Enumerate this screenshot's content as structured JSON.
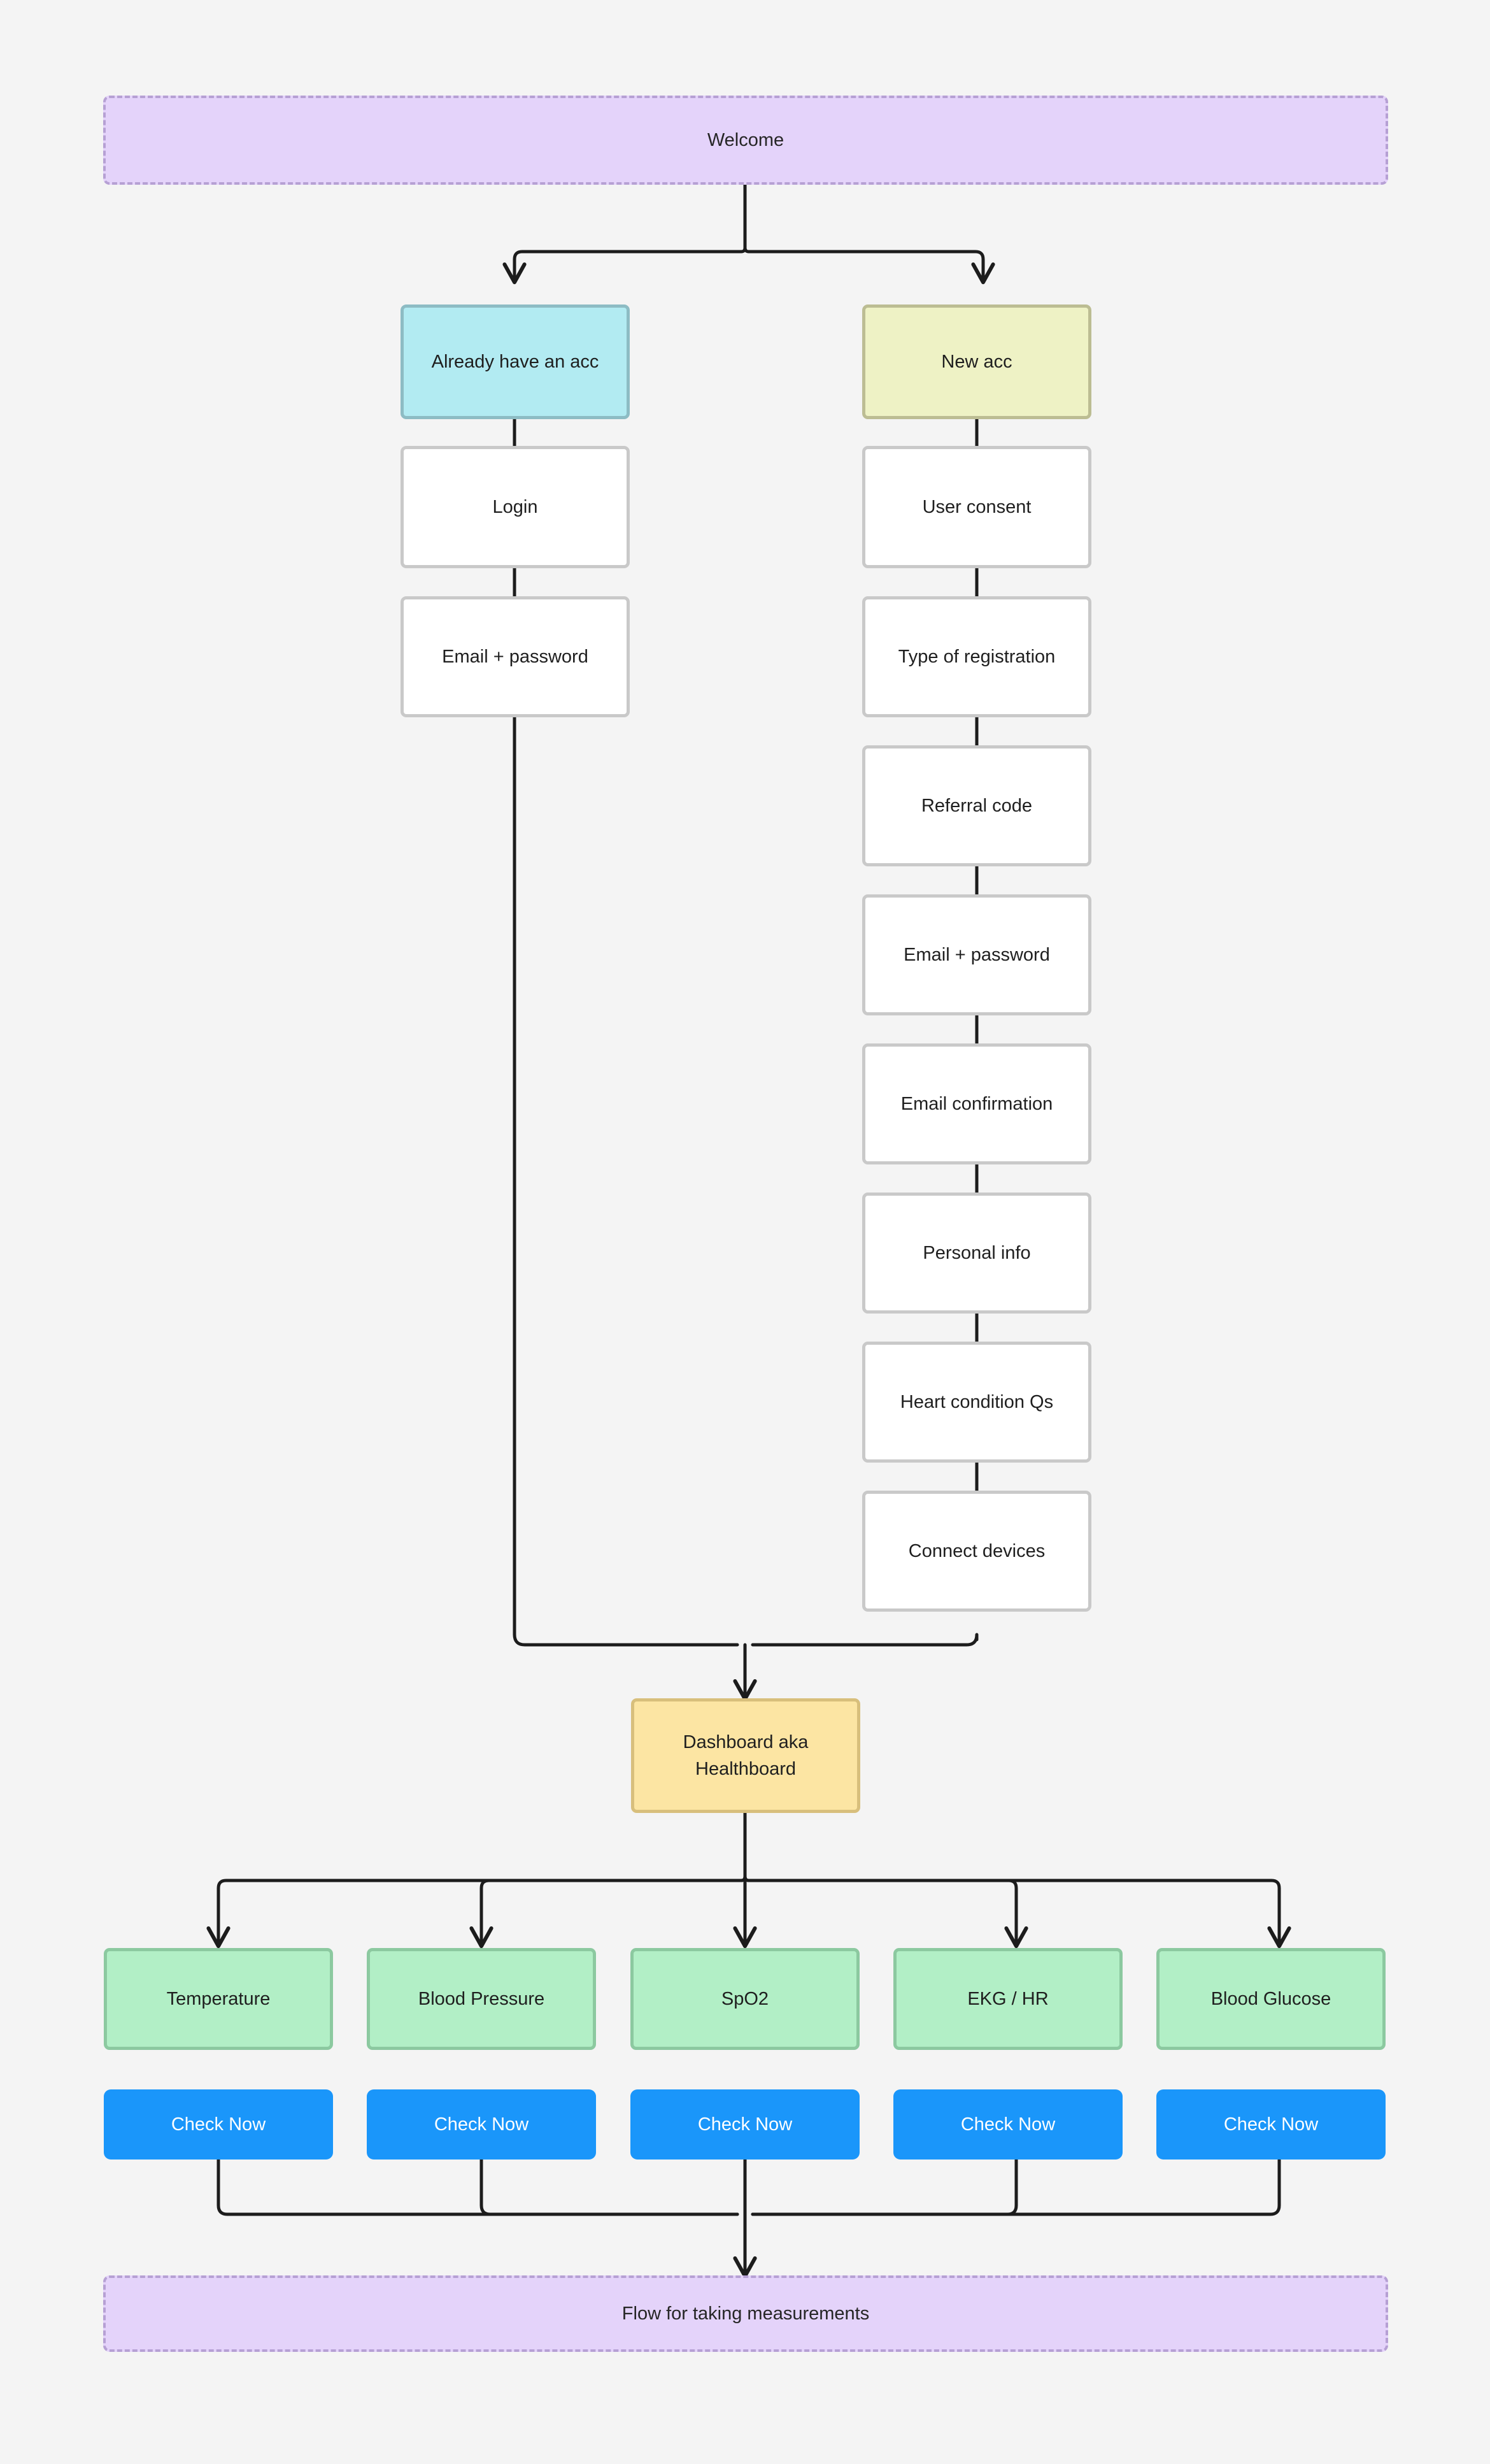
{
  "diagram": {
    "background_color": "#f4f4f4",
    "title_node": "Welcome",
    "phases": [
      {
        "id": "welcome",
        "label": "Welcome"
      },
      {
        "id": "flow_measurements",
        "label": "Flow for taking measurements"
      }
    ],
    "branches": [
      {
        "id": "existing_account",
        "label": "Already have an acc",
        "color": "#b2ebf2",
        "border_color": "#8dbcc4"
      },
      {
        "id": "new_account",
        "label": "New acc",
        "color": "#eef2c5",
        "border_color": "#bcbd93"
      }
    ],
    "login_steps": [
      {
        "id": "login",
        "label": "Login"
      },
      {
        "id": "login_email_password",
        "label": "Email + password"
      }
    ],
    "registration_steps": [
      {
        "id": "user_consent",
        "label": "User consent"
      },
      {
        "id": "type_of_registration",
        "label": "Type of registration"
      },
      {
        "id": "referral_code",
        "label": "Referral code"
      },
      {
        "id": "signup_email_password",
        "label": "Email + password"
      },
      {
        "id": "email_confirmation",
        "label": "Email confirmation"
      },
      {
        "id": "personal_info",
        "label": "Personal info"
      },
      {
        "id": "heart_condition_qs",
        "label": "Heart condition Qs"
      },
      {
        "id": "connect_devices",
        "label": "Connect devices"
      }
    ],
    "dashboard": {
      "id": "dashboard",
      "label": "Dashboard aka\nHealthboard",
      "color": "#fce5a3",
      "border_color": "#d8bf7c"
    },
    "metrics": [
      {
        "id": "temperature",
        "label": "Temperature",
        "cta": "Check Now"
      },
      {
        "id": "blood_pressure",
        "label": "Blood Pressure",
        "cta": "Check Now"
      },
      {
        "id": "spo2",
        "label": "SpO2",
        "cta": "Check Now"
      },
      {
        "id": "ekg_hr",
        "label": "EKG / HR",
        "cta": "Check Now"
      },
      {
        "id": "blood_glucose",
        "label": "Blood Glucose",
        "cta": "Check Now"
      }
    ],
    "colors": {
      "metric_fill": "#b2efc6",
      "metric_border": "#8cc9a0",
      "cta_fill": "#1a96fa",
      "cta_text": "#ffffff",
      "phase_fill": "#e4d3fa",
      "phase_border": "#b6a0d4",
      "step_fill": "#ffffff",
      "step_border": "#c9c9c9",
      "edge": "#1c1c1c"
    }
  }
}
